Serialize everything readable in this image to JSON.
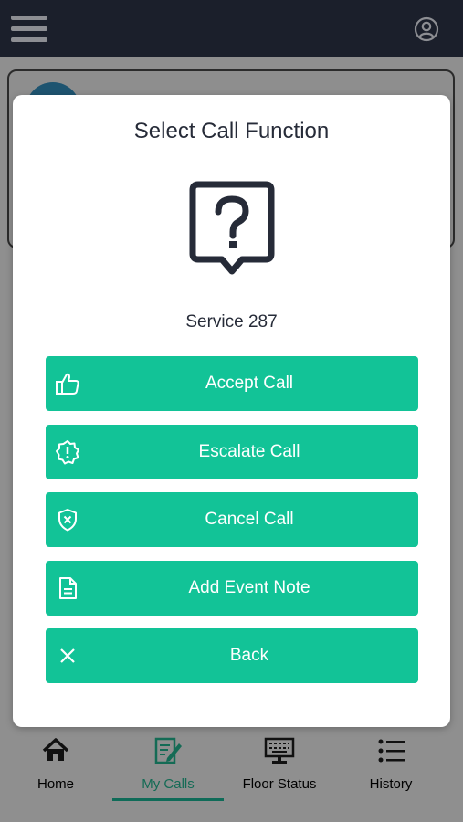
{
  "modal": {
    "title": "Select Call Function",
    "service": "Service 287",
    "buttons": [
      {
        "label": "Accept Call",
        "icon": "thumbs-up-icon"
      },
      {
        "label": "Escalate Call",
        "icon": "alert-badge-icon"
      },
      {
        "label": "Cancel Call",
        "icon": "shield-x-icon"
      },
      {
        "label": "Add Event Note",
        "icon": "document-icon"
      },
      {
        "label": "Back",
        "icon": "close-icon"
      }
    ]
  },
  "nav": {
    "items": [
      {
        "label": "Home",
        "icon": "home-icon"
      },
      {
        "label": "My Calls",
        "icon": "edit-note-icon",
        "active": true
      },
      {
        "label": "Floor Status",
        "icon": "monitor-icon"
      },
      {
        "label": "History",
        "icon": "list-icon"
      }
    ]
  },
  "colors": {
    "accent": "#12c397",
    "header": "#1b1f2b",
    "text_dark": "#262b38",
    "overlay": "#8f8f8f",
    "active_nav": "#146b55"
  }
}
